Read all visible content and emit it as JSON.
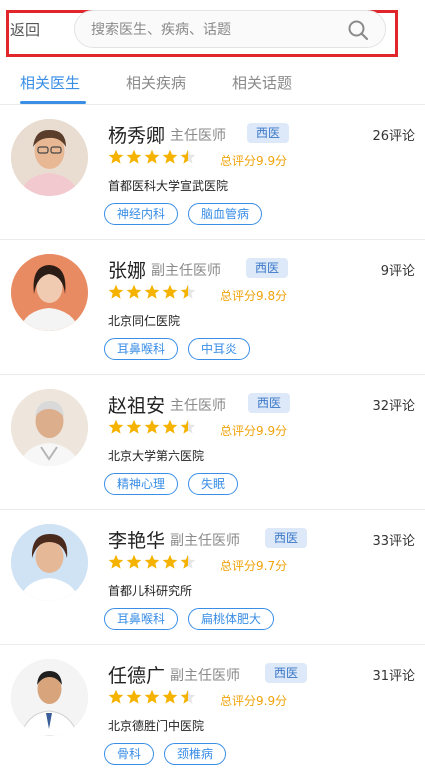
{
  "header": {
    "back_label": "返回",
    "search_placeholder": "搜索医生、疾病、话题"
  },
  "tabs": [
    {
      "label": "相关医生",
      "active": true
    },
    {
      "label": "相关疾病",
      "active": false
    },
    {
      "label": "相关话题",
      "active": false
    }
  ],
  "colors": {
    "accent": "#3a8ee6",
    "star": "#f5b300",
    "highlight": "#e0262b"
  },
  "doctors": [
    {
      "name": "杨秀卿",
      "title": "主任医师",
      "badge": "西医",
      "reviews": "26评论",
      "rating": 4.5,
      "score_text": "总评分9.9分",
      "hospital": "首都医科大学宣武医院",
      "tags": [
        "神经内科",
        "脑血管病"
      ]
    },
    {
      "name": "张娜",
      "title": "副主任医师",
      "badge": "西医",
      "reviews": "9评论",
      "rating": 4.5,
      "score_text": "总评分9.8分",
      "hospital": "北京同仁医院",
      "tags": [
        "耳鼻喉科",
        "中耳炎"
      ]
    },
    {
      "name": "赵祖安",
      "title": "主任医师",
      "badge": "西医",
      "reviews": "32评论",
      "rating": 4.5,
      "score_text": "总评分9.9分",
      "hospital": "北京大学第六医院",
      "tags": [
        "精神心理",
        "失眠"
      ]
    },
    {
      "name": "李艳华",
      "title": "副主任医师",
      "badge": "西医",
      "reviews": "33评论",
      "rating": 4.5,
      "score_text": "总评分9.7分",
      "hospital": "首都儿科研究所",
      "tags": [
        "耳鼻喉科",
        "扁桃体肥大"
      ]
    },
    {
      "name": "任德广",
      "title": "副主任医师",
      "badge": "西医",
      "reviews": "31评论",
      "rating": 4.5,
      "score_text": "总评分9.9分",
      "hospital": "北京德胜门中医院",
      "tags": [
        "骨科",
        "颈椎病"
      ]
    }
  ]
}
